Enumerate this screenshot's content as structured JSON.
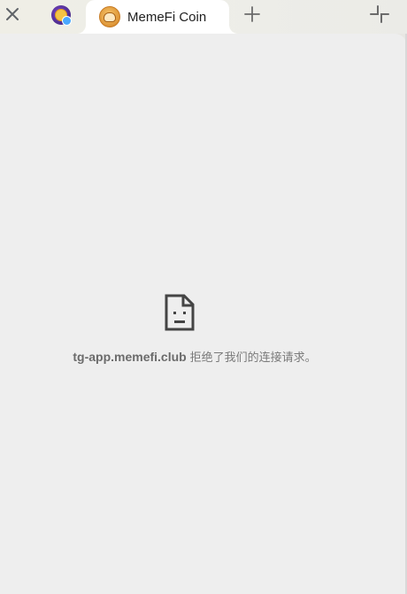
{
  "tabs": [
    {
      "title": "",
      "icon": "trophy-coin-favicon-icon",
      "active": false
    },
    {
      "title": "MemeFi Coin",
      "icon": "memefi-coin-favicon-icon",
      "active": true
    }
  ],
  "toolbar": {
    "close_icon": "close-icon",
    "new_tab_icon": "plus-icon",
    "minimize_icon": "minimize-icon"
  },
  "error": {
    "icon": "sad-page-icon",
    "host": "tg-app.memefi.club",
    "message": "拒绝了我们的连接请求。"
  },
  "colors": {
    "tabbar_bg": "#eeeee8",
    "active_tab_bg": "#ffffff",
    "content_bg": "#eeeeee",
    "error_text": "#6b6b6b"
  }
}
